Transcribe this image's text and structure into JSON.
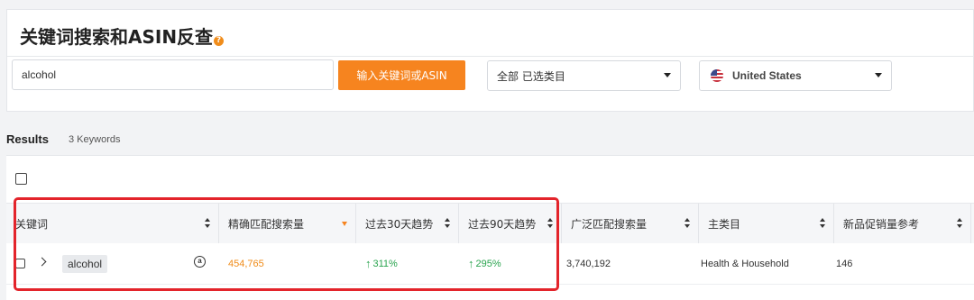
{
  "page": {
    "title": "关键词搜索和ASIN反查",
    "title_badge": "?"
  },
  "search": {
    "value": "alcohol",
    "button_label": "输入关键词或ASIN"
  },
  "filters": {
    "category": "全部 已选类目",
    "country": "United States"
  },
  "results": {
    "heading": "Results",
    "count": "3 Keywords"
  },
  "table": {
    "headers": [
      "关键词",
      "精确匹配搜索量",
      "过去30天趋势",
      "过去90天趋势",
      "广泛匹配搜索量",
      "主类目",
      "新品促销量参考"
    ],
    "row": {
      "keyword": "alcohol",
      "exact_volume": "454,765",
      "trend_30": "311%",
      "trend_90": "295%",
      "broad_volume": "3,740,192",
      "category": "Health & Household",
      "promo": "146"
    }
  },
  "colors": {
    "accent": "#f6841f",
    "trend_up": "#2aa44f",
    "highlight": "#e3242b"
  },
  "icons": {
    "expand": "chevron-right-icon",
    "amazon": "amazon-icon",
    "trend": "arrow-up-icon",
    "flag": "us-flag-icon"
  }
}
